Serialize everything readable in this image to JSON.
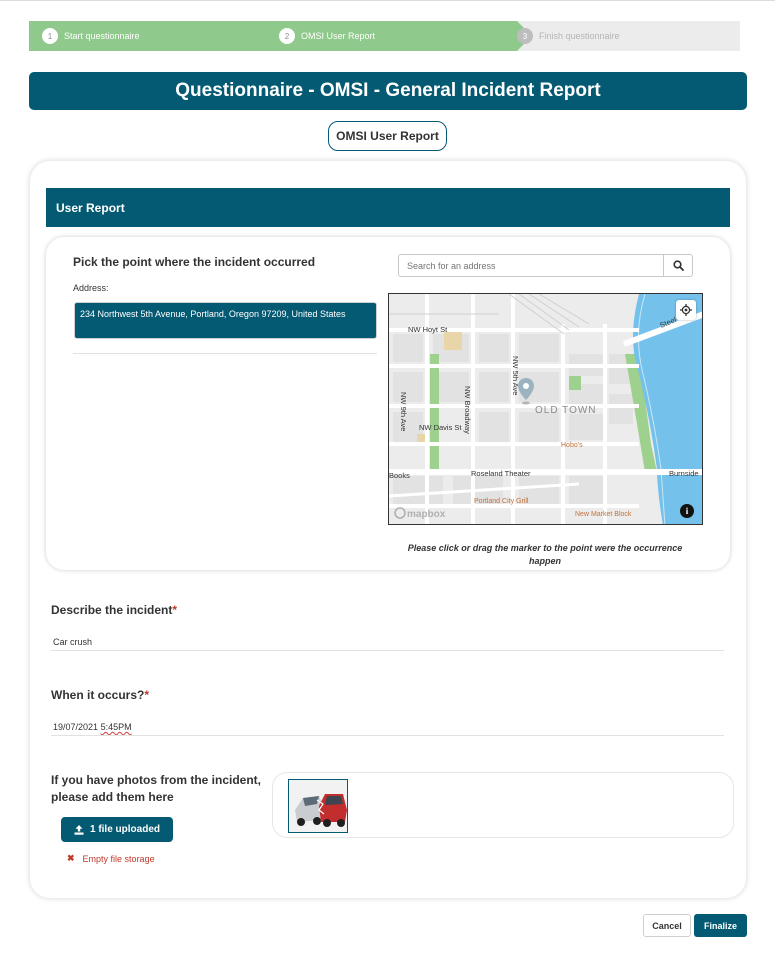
{
  "stepper": {
    "steps": [
      {
        "number": "1",
        "label": "Start questionnaire",
        "state": "done"
      },
      {
        "number": "2",
        "label": "OMSI User Report",
        "state": "active"
      },
      {
        "number": "3",
        "label": "Finish questionnaire",
        "state": "todo"
      }
    ]
  },
  "title": "Questionnaire - OMSI - General Incident Report",
  "section_tab": "OMSI User Report",
  "report_header": "User Report",
  "location": {
    "heading": "Pick the point where the incident occurred",
    "address_label": "Address:",
    "address_value": "234 Northwest 5th Avenue, Portland, Oregon 97209, United States",
    "search_placeholder": "Search for an address",
    "caption": "Please click or drag the marker to the point were the occurrence happen"
  },
  "map": {
    "labels": {
      "hoyt": "NW Hoyt St",
      "fifth": "NW 5th Ave",
      "broadway": "NW Broadway",
      "ninth": "NW 9th Ave",
      "davis": "NW Davis St",
      "oldtown": "OLD TOWN",
      "hobos": "Hobo's",
      "roseland": "Roseland Theater",
      "burnside": "Burnside",
      "books": "Books",
      "portland_city_grill": "Portland City Grill",
      "new_market": "New Market Block",
      "steel": "Steel",
      "mapbox": "mapbox"
    },
    "colors": {
      "water": "#74c1ec",
      "park": "#9ed08e",
      "road": "#ffffff",
      "land": "#ececec"
    }
  },
  "incident": {
    "describe_label": "Describe the incident",
    "describe_value": "Car crush",
    "when_label": "When it occurs?",
    "when_date": "19/07/2021",
    "when_time": "5:45PM",
    "required_mark": "*"
  },
  "photos": {
    "label": "If you have photos from the incident, please add them here",
    "upload_button": "1 file uploaded",
    "error": "Empty file storage"
  },
  "footer": {
    "cancel": "Cancel",
    "finalize": "Finalize"
  },
  "colors": {
    "primary": "#055a73",
    "step_done": "#90c98c",
    "error": "#c0392b"
  }
}
